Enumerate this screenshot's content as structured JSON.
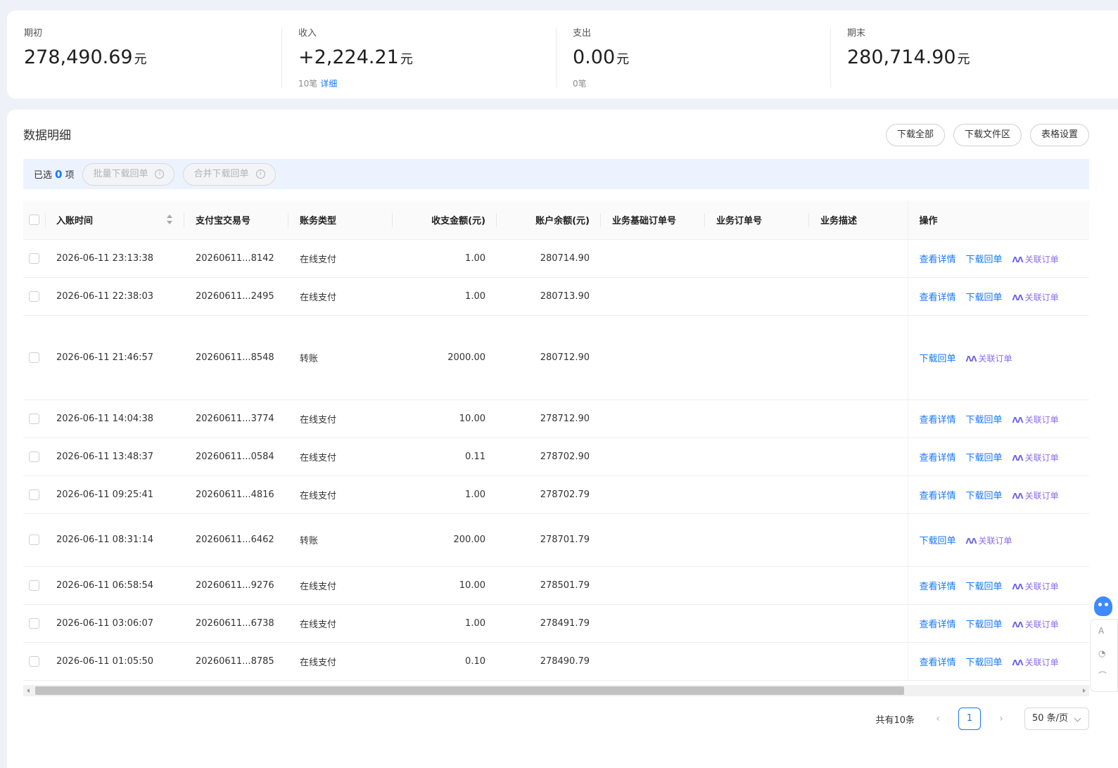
{
  "summary": [
    {
      "label": "期初",
      "amount": "278,490.69",
      "unit": "元",
      "sub": "",
      "link": ""
    },
    {
      "label": "收入",
      "amount": "+2,224.21",
      "unit": "元",
      "sub": "10笔",
      "link": "详细"
    },
    {
      "label": "支出",
      "amount": "0.00",
      "unit": "元",
      "sub": "0笔",
      "link": ""
    },
    {
      "label": "期末",
      "amount": "280,714.90",
      "unit": "元",
      "sub": "",
      "link": ""
    }
  ],
  "detail": {
    "title": "数据明细",
    "buttons": {
      "download_all": "下载全部",
      "download_area": "下载文件区",
      "table_settings": "表格设置"
    }
  },
  "selection": {
    "prefix": "已选",
    "count": "0",
    "suffix": "项",
    "batch_download": "批量下载回单",
    "merge_download": "合并下载回单"
  },
  "table": {
    "headers": {
      "time": "入账时间",
      "trade_no": "支付宝交易号",
      "type": "账务类型",
      "amount": "收支金额(元)",
      "balance": "账户余额(元)",
      "base_order": "业务基础订单号",
      "order": "业务订单号",
      "desc": "业务描述",
      "op": "操作"
    },
    "actions": {
      "view": "查看详情",
      "download": "下载回单",
      "link_order": "关联订单",
      "ai_mark": "AI"
    },
    "rows": [
      {
        "time": "2026-06-11 23:13:38",
        "trade_no": "20260611...8142",
        "type": "在线支付",
        "amount": "1.00",
        "balance": "280714.90",
        "has_view": true,
        "tall": false
      },
      {
        "time": "2026-06-11 22:38:03",
        "trade_no": "20260611...2495",
        "type": "在线支付",
        "amount": "1.00",
        "balance": "280713.90",
        "has_view": true,
        "tall": false
      },
      {
        "time": "2026-06-11 21:46:57",
        "trade_no": "20260611...8548",
        "type": "转账",
        "amount": "2000.00",
        "balance": "280712.90",
        "has_view": false,
        "tall": true
      },
      {
        "time": "2026-06-11 14:04:38",
        "trade_no": "20260611...3774",
        "type": "在线支付",
        "amount": "10.00",
        "balance": "278712.90",
        "has_view": true,
        "tall": false
      },
      {
        "time": "2026-06-11 13:48:37",
        "trade_no": "20260611...0584",
        "type": "在线支付",
        "amount": "0.11",
        "balance": "278702.90",
        "has_view": true,
        "tall": false
      },
      {
        "time": "2026-06-11 09:25:41",
        "trade_no": "20260611...4816",
        "type": "在线支付",
        "amount": "1.00",
        "balance": "278702.79",
        "has_view": true,
        "tall": false
      },
      {
        "time": "2026-06-11 08:31:14",
        "trade_no": "20260611...6462",
        "type": "转账",
        "amount": "200.00",
        "balance": "278701.79",
        "has_view": false,
        "tall": "mid"
      },
      {
        "time": "2026-06-11 06:58:54",
        "trade_no": "20260611...9276",
        "type": "在线支付",
        "amount": "10.00",
        "balance": "278501.79",
        "has_view": true,
        "tall": false
      },
      {
        "time": "2026-06-11 03:06:07",
        "trade_no": "20260611...6738",
        "type": "在线支付",
        "amount": "1.00",
        "balance": "278491.79",
        "has_view": true,
        "tall": false
      },
      {
        "time": "2026-06-11 01:05:50",
        "trade_no": "20260611...8785",
        "type": "在线支付",
        "amount": "0.10",
        "balance": "278490.79",
        "has_view": true,
        "tall": false
      }
    ]
  },
  "pagination": {
    "total": "共有10条",
    "current": "1",
    "page_size": "50 条/页"
  },
  "side_panel": {
    "item_a": "A",
    "item_b": "◔",
    "item_c": "⌒"
  }
}
